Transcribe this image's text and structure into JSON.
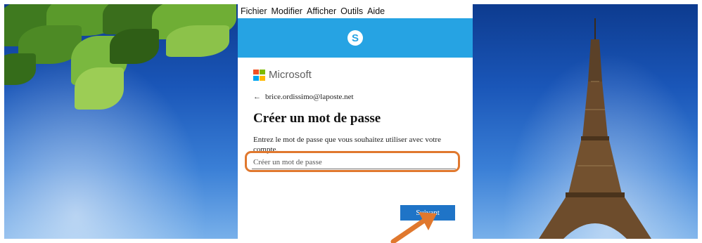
{
  "menubar": {
    "items": [
      "Fichier",
      "Modifier",
      "Afficher",
      "Outils",
      "Aide"
    ]
  },
  "header": {
    "logo_glyph": "S",
    "logo_name": "skype-icon",
    "brand_color": "#26a3e3"
  },
  "signin": {
    "brand_name": "Microsoft",
    "back_arrow": "←",
    "email": "brice.ordissimo@laposte.net",
    "title": "Créer un mot de passe",
    "description": "Entrez le mot de passe que vous souhaitez utiliser avec votre compte.",
    "password_placeholder": "Créer un mot de passe",
    "password_value": "",
    "next_label": "Suivant"
  },
  "annotations": {
    "highlight_color": "#e0782e"
  }
}
